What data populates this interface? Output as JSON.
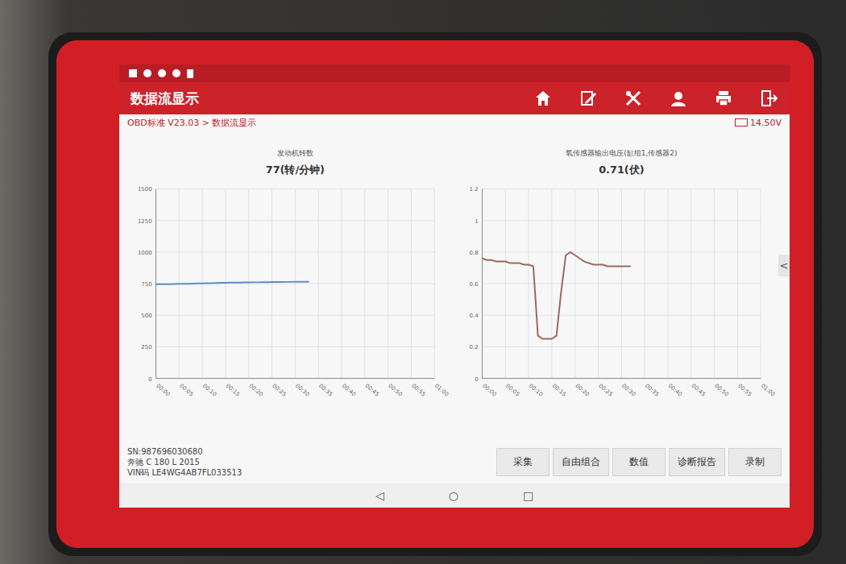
{
  "header": {
    "title": "数据流显示"
  },
  "breadcrumb": "OBD标准 V23.03 > 数据流显示",
  "battery": "14.50V",
  "charts": [
    {
      "title": "发动机转数",
      "reading": "77",
      "unit": "(转/分钟)",
      "color": "#5b8dc9",
      "y_ticks": [
        "1500",
        "1250",
        "1000",
        "750",
        "500",
        "250",
        "0"
      ],
      "x_ticks": [
        "00:00",
        "00:05",
        "00:10",
        "00:15",
        "00:20",
        "00:25",
        "00:30",
        "00:35",
        "00:40",
        "00:45",
        "00:50",
        "00:55",
        "01:00"
      ],
      "values": [
        745,
        745,
        746,
        746,
        747,
        748,
        748,
        749,
        750,
        751,
        752,
        753,
        754,
        755,
        756,
        757,
        758,
        758,
        759,
        760,
        760,
        761,
        761,
        762,
        762,
        763,
        763,
        763,
        764,
        764,
        765,
        765,
        765,
        765
      ]
    },
    {
      "title": "氧传感器输出电压(缸组1,传感器2)",
      "reading": "0.71",
      "unit": "(伏)",
      "color": "#9a6a5e",
      "y_ticks": [
        "1.2",
        "1",
        "0.8",
        "0.6",
        "0.4",
        "0.2",
        "0"
      ],
      "x_ticks": [
        "00:00",
        "00:05",
        "00:10",
        "00:15",
        "00:20",
        "00:25",
        "00:30",
        "00:35",
        "00:40",
        "00:45",
        "00:50",
        "00:55",
        "01:00"
      ],
      "values": [
        0.76,
        0.75,
        0.75,
        0.74,
        0.74,
        0.74,
        0.73,
        0.73,
        0.73,
        0.72,
        0.72,
        0.71,
        0.27,
        0.25,
        0.25,
        0.25,
        0.27,
        0.55,
        0.78,
        0.8,
        0.78,
        0.76,
        0.74,
        0.73,
        0.72,
        0.72,
        0.72,
        0.71,
        0.71,
        0.71,
        0.71,
        0.71,
        0.71
      ]
    }
  ],
  "side_arrow": "<",
  "vehicle": {
    "sn": "SN:987696030680",
    "model": "奔驰 C 180 L 2015",
    "vin": "VIN码 LE4WG4AB7FL033513"
  },
  "buttons": [
    "采集",
    "自由组合",
    "数值",
    "诊断报告",
    "录制"
  ],
  "nav": [
    "◁",
    "○",
    "□"
  ]
}
